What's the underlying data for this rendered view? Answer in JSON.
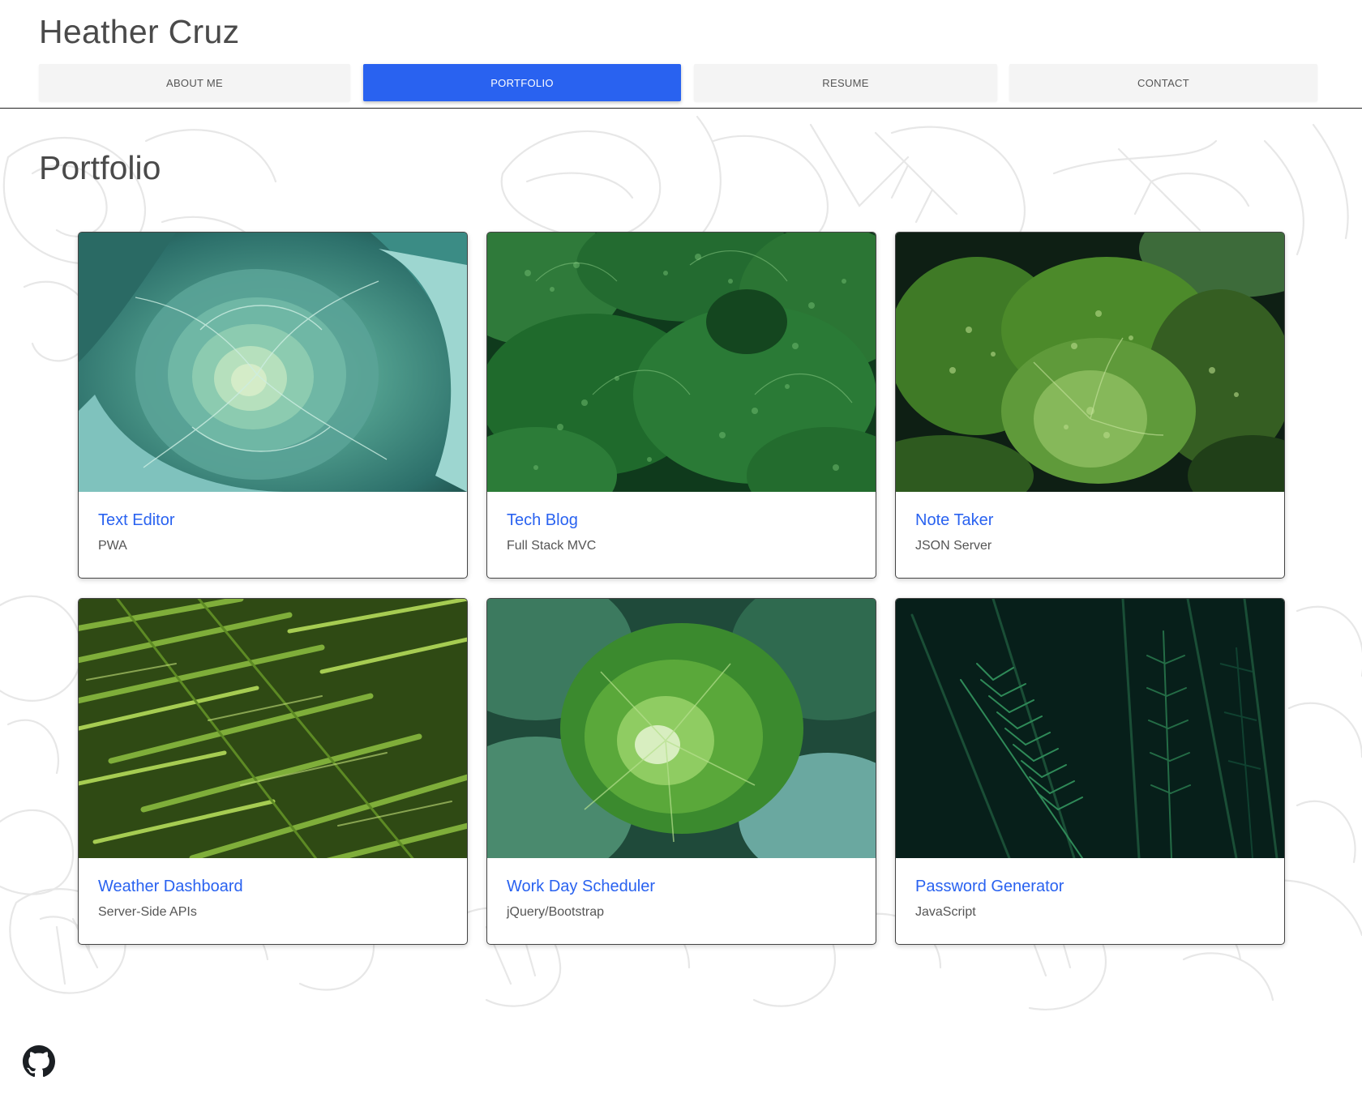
{
  "header": {
    "site_title": "Heather Cruz"
  },
  "nav": {
    "tabs": [
      {
        "label": "ABOUT ME",
        "active": false
      },
      {
        "label": "PORTFOLIO",
        "active": true
      },
      {
        "label": "RESUME",
        "active": false
      },
      {
        "label": "CONTACT",
        "active": false
      }
    ]
  },
  "portfolio": {
    "title": "Portfolio",
    "projects": [
      {
        "title": "Text Editor",
        "subtitle": "PWA",
        "image": "cabbage-photo"
      },
      {
        "title": "Tech Blog",
        "subtitle": "Full Stack MVC",
        "image": "savoy-leaves-photo"
      },
      {
        "title": "Note Taker",
        "subtitle": "JSON Server",
        "image": "savoy-cabbage-photo"
      },
      {
        "title": "Weather Dashboard",
        "subtitle": "Server-Side APIs",
        "image": "fern-photo"
      },
      {
        "title": "Work Day Scheduler",
        "subtitle": "jQuery/Bootstrap",
        "image": "leafy-greens-photo"
      },
      {
        "title": "Password Generator",
        "subtitle": "JavaScript",
        "image": "pine-branches-photo"
      }
    ]
  },
  "footer": {
    "icon": "github-icon"
  },
  "colors": {
    "accent": "#2962f0",
    "tab_background": "#f4f4f4",
    "title_text": "#4a4a4a"
  }
}
